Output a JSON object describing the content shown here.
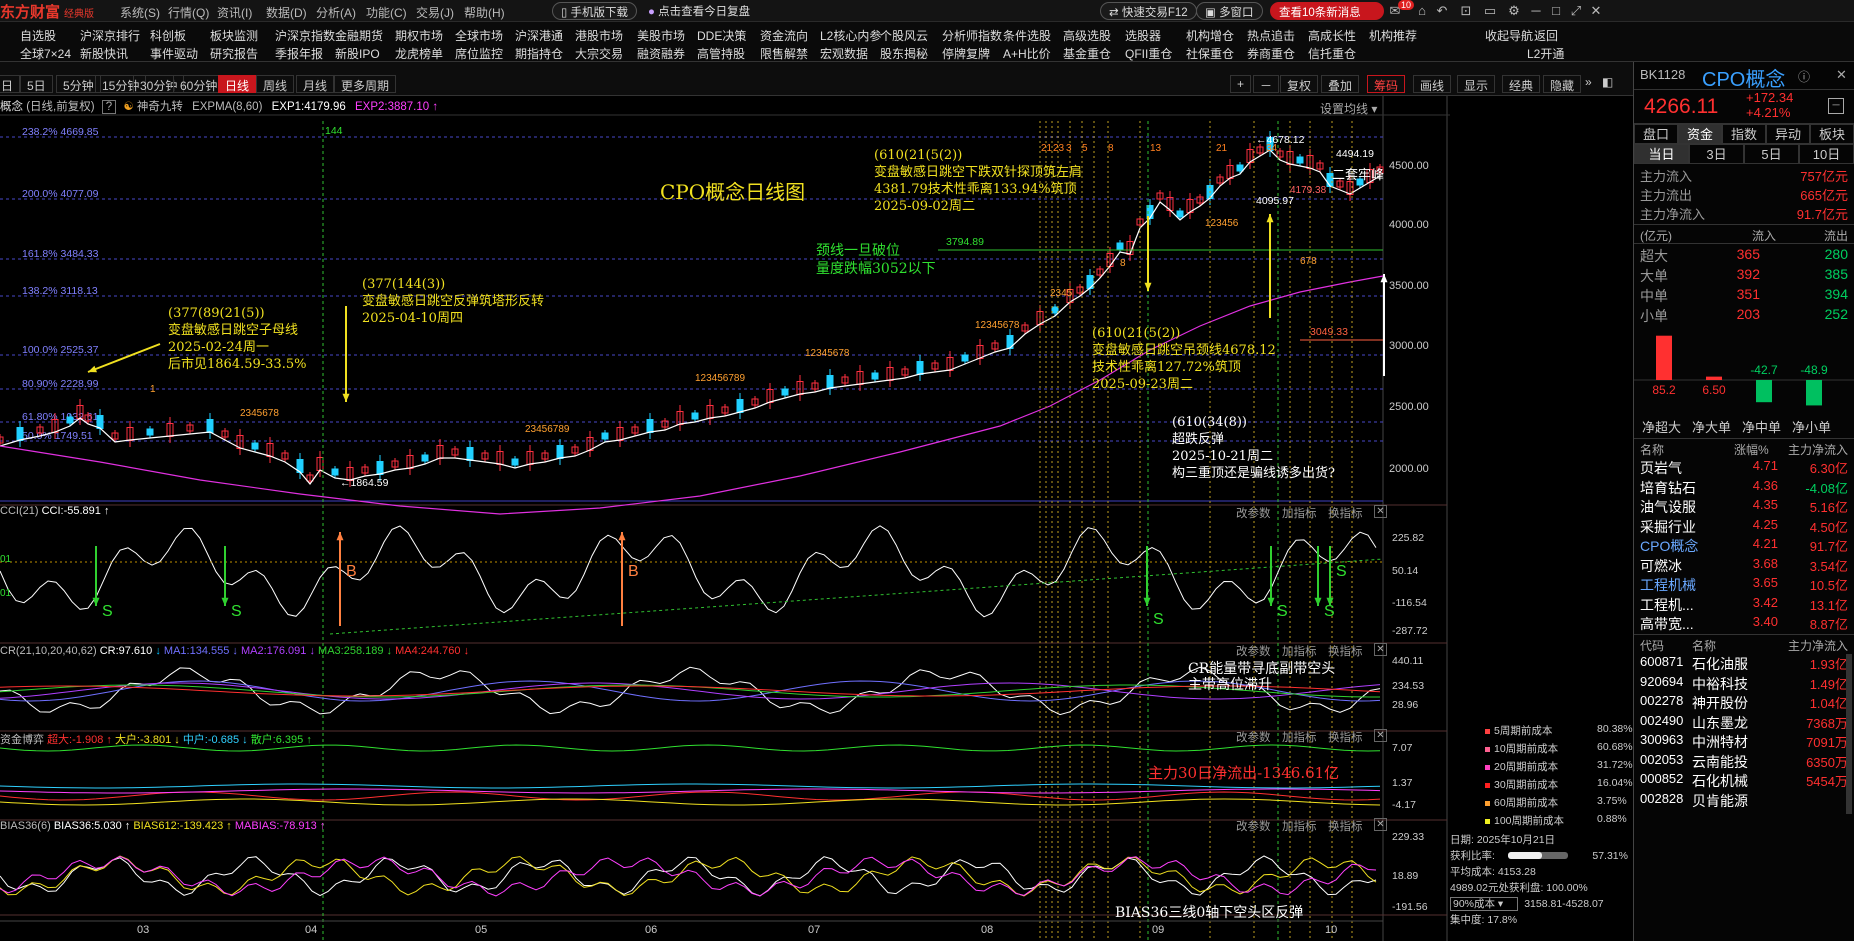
{
  "app": {
    "logo": "东方财富",
    "edition": "经典版"
  },
  "menu": [
    "系统(S)",
    "行情(Q)",
    "资讯(I)",
    "数据(D)",
    "分析(A)",
    "功能(C)",
    "交易(J)",
    "帮助(H)"
  ],
  "top_pills": {
    "mobile": "手机版下载",
    "review": "点击查看今日复盘",
    "quick_trade": "快速交易F12",
    "multi_window": "多窗口",
    "news": "查看10条新消息",
    "news_badge": "10"
  },
  "nav_row1": [
    "自选股",
    "沪深京排行",
    "科创板",
    "板块监测",
    "沪深京指数",
    "金融期货",
    "期权市场",
    "全球市场",
    "沪深港通",
    "港股市场",
    "美股市场",
    "DDE决策",
    "资金流向",
    "L2核心内参",
    "个股风云",
    "分析师指数",
    "条件选股",
    "高级选股",
    "选股器",
    "机构增仓",
    "热点追击",
    "高成长性",
    "机构推荐",
    "收起导航",
    "返回"
  ],
  "nav_row2": [
    "全球7×24",
    "新股快讯",
    "事件驱动",
    "研究报告",
    "季报年报",
    "新股IPO",
    "龙虎榜单",
    "席位监控",
    "期指持仓",
    "大宗交易",
    "融资融券",
    "高管持股",
    "限售解禁",
    "宏观数据",
    "股东揭秘",
    "停牌复牌",
    "A+H比价",
    "基金重仓",
    "QFII重仓",
    "社保重仓",
    "券商重仓",
    "信托重仓",
    "L2开通"
  ],
  "periods": [
    "日",
    "5日",
    "5分钟",
    "15分钟",
    "30分钟",
    "60分钟",
    "日线",
    "周线",
    "月线",
    "更多周期"
  ],
  "period_active": "日线",
  "chart_tools": [
    "+",
    "－",
    "复权",
    "叠加",
    "筹码",
    "画线",
    "显示",
    "经典",
    "隐藏"
  ],
  "chart_header": {
    "name": "概念",
    "mode": "(日线,前复权)",
    "q": "?",
    "indicator": "神奇九转",
    "expma": "EXPMA(8,60)",
    "exp1": "EXP1:4179.96",
    "exp2": "EXP2:3887.10",
    "settings": "设置均线"
  },
  "chart_data": {
    "type": "candlestick",
    "title": "CPO概念日线图",
    "x_months": [
      "03",
      "04",
      "05",
      "06",
      "07",
      "08",
      "09",
      "10"
    ],
    "yaxis_right": [
      "4500.00",
      "4000.00",
      "3500.00",
      "3000.00",
      "2500.00",
      "2000.00"
    ],
    "fib_levels": [
      "238.2% 4669.85",
      "200.0% 4077.09",
      "161.8% 3484.33",
      "138.2% 3118.13",
      "100.0% 2525.37",
      "80.90% 2228.99",
      "61.80% 1932.61",
      "50.0% 1749.51"
    ],
    "price_labels": {
      "high": "4678.12",
      "low": "1864.59",
      "p1": "4494.19",
      "p2": "4095.97",
      "p3": "4179.38",
      "neck": "3794.89",
      "p5": "3049.33",
      "vline": "144"
    },
    "vline_nums": [
      "21",
      "23",
      "3",
      "5",
      "8",
      "13",
      "21",
      "34"
    ]
  },
  "annotations": {
    "a1": [
      "(377(89(21(5))",
      "变盘敏感日跳空子母线",
      "2025-02-24周一",
      "后市见1864.59-33.5%"
    ],
    "a2": [
      "(377(144(3))",
      "变盘敏感日跳空反弹筑塔形反转",
      "2025-04-10周四"
    ],
    "a3": [
      "(610(21(5(2))",
      "变盘敏感日跳空下跌双针探顶筑左肩",
      "4381.79技术性乖离133.94%筑顶",
      "2025-09-02周二"
    ],
    "a4": [
      "颈线一旦破位",
      "量度跌幅3052以下"
    ],
    "a5": [
      "(610(21(5(2))",
      "变盘敏感日跳空吊颈线4678.12",
      "技术性乖离127.72%筑顶",
      "2025-09-23周二"
    ],
    "a6": [
      "(610(34(8))",
      "超跌反弹",
      "2025-10-21周二",
      "构三重顶还是骗线诱多出货?"
    ],
    "a7": "二套牢峰"
  },
  "ind_cci": {
    "title": "CCI(21)",
    "value": "CCI:-55.891",
    "axis": [
      "225.82",
      "50.14",
      "-116.54",
      "-287.72"
    ],
    "ctl": [
      "改参数",
      "加指标",
      "换指标"
    ],
    "marks_s": [
      "S",
      "S",
      "S",
      "S",
      "S",
      "S"
    ],
    "marks_b": [
      "B",
      "B"
    ],
    "left": [
      "01",
      "01"
    ]
  },
  "ind_cr": {
    "title": "CR(21,10,20,40,62)",
    "values": [
      "CR:97.610",
      "MA1:134.555",
      "MA2:176.091",
      "MA3:258.189",
      "MA4:244.760"
    ],
    "axis": [
      "440.11",
      "234.53",
      "28.96"
    ],
    "note": [
      "CR能量带寻底副带空头",
      "主带高位滞升"
    ]
  },
  "ind_money": {
    "title": "资金博弈",
    "values": [
      "超大:-1.908",
      "大户:-3.801",
      "中户:-0.685",
      "散户:6.395"
    ],
    "axis": [
      "7.07",
      "1.37",
      "-4.17"
    ],
    "note": "主力30日净流出-1346.61亿"
  },
  "ind_bias": {
    "title": "BIAS36(6)",
    "values": [
      "BIAS36:5.030",
      "BIAS612:-139.423",
      "MABIAS:-78.913"
    ],
    "axis": [
      "229.33",
      "18.89",
      "-191.56"
    ],
    "note": "BIAS36三线0轴下空头区反弹"
  },
  "cost_legend": [
    {
      "label": "5周期前成本",
      "val": "80.38%",
      "color": "#ff4040"
    },
    {
      "label": "10周期前成本",
      "val": "60.68%",
      "color": "#ff6090"
    },
    {
      "label": "20周期前成本",
      "val": "31.72%",
      "color": "#ff40c0"
    },
    {
      "label": "30周期前成本",
      "val": "16.04%",
      "color": "#ff2020"
    },
    {
      "label": "60周期前成本",
      "val": "3.75%",
      "color": "#ffa030"
    },
    {
      "label": "100周期前成本",
      "val": "0.88%",
      "color": "#f0f020"
    }
  ],
  "chip_info": {
    "date": "日期: 2025年10月21日",
    "profit": "获利比率:",
    "profit_val": "57.31%",
    "avg": "平均成本: 4153.28",
    "note": "4989.02元处获利盘: 100.00%",
    "cost_sel": "90%成本",
    "range": "3158.81-4528.07",
    "conc": "集中度: 17.8%"
  },
  "right": {
    "code": "BK1128",
    "name": "CPO概念",
    "price": "4266.11",
    "chg": "+172.34",
    "pct": "+4.21%",
    "tabs": [
      "盘口",
      "资金",
      "指数",
      "异动",
      "板块"
    ],
    "tab_active": "资金",
    "subtabs": [
      "当日",
      "3日",
      "5日",
      "10日"
    ],
    "flow": [
      [
        "主力流入",
        "757亿元"
      ],
      [
        "主力流出",
        "665亿元"
      ],
      [
        "主力净流入",
        "91.7亿元"
      ]
    ],
    "unit": "(亿元)",
    "flow_h": [
      "流入",
      "流出"
    ],
    "orders": [
      [
        "超大",
        "365",
        "280"
      ],
      [
        "大单",
        "392",
        "385"
      ],
      [
        "中单",
        "351",
        "394"
      ],
      [
        "小单",
        "203",
        "252"
      ]
    ],
    "bars": [
      {
        "label": "净超大",
        "v": 85.2,
        "t": "85.2"
      },
      {
        "label": "净大单",
        "v": 6.5,
        "t": "6.50"
      },
      {
        "label": "净中单",
        "v": -42.7,
        "t": "-42.7"
      },
      {
        "label": "净小单",
        "v": -48.9,
        "t": "-48.9"
      }
    ],
    "sect_h": [
      "名称",
      "涨幅%",
      "主力净流入"
    ],
    "sectors": [
      [
        "页岩气",
        "4.71",
        "6.30亿"
      ],
      [
        "培育钻石",
        "4.36",
        "-4.08亿"
      ],
      [
        "油气设服",
        "4.35",
        "5.16亿"
      ],
      [
        "采掘行业",
        "4.25",
        "4.50亿"
      ],
      [
        "CPO概念",
        "4.21",
        "91.7亿"
      ],
      [
        "可燃冰",
        "3.68",
        "3.54亿"
      ],
      [
        "工程机械",
        "3.65",
        "10.5亿"
      ],
      [
        "工程机...",
        "3.42",
        "13.1亿"
      ],
      [
        "高带宽...",
        "3.40",
        "8.87亿"
      ]
    ],
    "stock_h": [
      "代码",
      "名称",
      "主力净流入"
    ],
    "stocks": [
      [
        "600871",
        "石化油服",
        "1.93亿"
      ],
      [
        "920694",
        "中裕科技",
        "1.49亿"
      ],
      [
        "002278",
        "神开股份",
        "1.04亿"
      ],
      [
        "002490",
        "山东墨龙",
        "7368万"
      ],
      [
        "300963",
        "中洲特材",
        "7091万"
      ],
      [
        "002053",
        "云南能投",
        "6350万"
      ],
      [
        "000852",
        "石化机械",
        "5454万"
      ],
      [
        "002828",
        "贝肯能源",
        ""
      ]
    ]
  }
}
